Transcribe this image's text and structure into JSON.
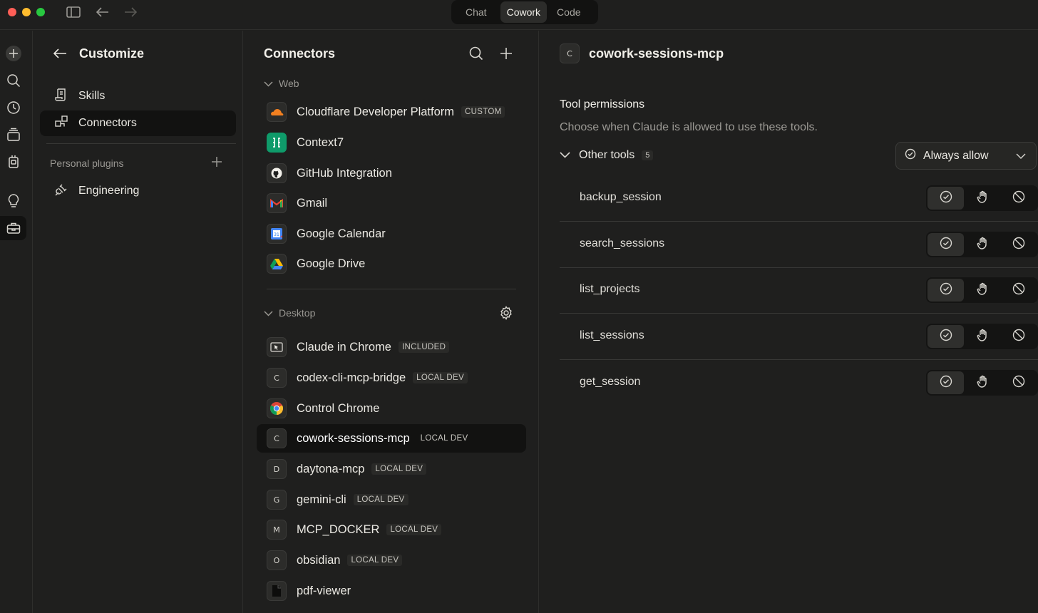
{
  "titlebar": {
    "mode_tabs": [
      "Chat",
      "Cowork",
      "Code"
    ],
    "active_mode": "Cowork",
    "traffic_colors": [
      "#ff5f57",
      "#febc2e",
      "#28c840"
    ]
  },
  "customize": {
    "title": "Customize",
    "nav": [
      {
        "label": "Skills",
        "icon": "scroll-icon"
      },
      {
        "label": "Connectors",
        "icon": "connectors-icon",
        "active": true
      }
    ],
    "personal_plugins_label": "Personal plugins",
    "plugins": [
      {
        "label": "Engineering",
        "icon": "plug-icon"
      }
    ]
  },
  "connectors": {
    "title": "Connectors",
    "web_section": "Web",
    "desktop_section": "Desktop",
    "web": [
      {
        "name": "Cloudflare Developer Platform",
        "badge": "CUSTOM",
        "icon": "cloudflare-icon"
      },
      {
        "name": "Context7",
        "badge": "",
        "icon": "context7-icon"
      },
      {
        "name": "GitHub Integration",
        "badge": "",
        "icon": "github-icon"
      },
      {
        "name": "Gmail",
        "badge": "",
        "icon": "gmail-icon"
      },
      {
        "name": "Google Calendar",
        "badge": "",
        "icon": "google-calendar-icon"
      },
      {
        "name": "Google Drive",
        "badge": "",
        "icon": "google-drive-icon"
      }
    ],
    "desktop": [
      {
        "name": "Claude in Chrome",
        "badge": "INCLUDED",
        "icon": "claude-chrome-icon",
        "letter": ""
      },
      {
        "name": "codex-cli-mcp-bridge",
        "badge": "LOCAL DEV",
        "icon": "letter-icon",
        "letter": "C"
      },
      {
        "name": "Control Chrome",
        "badge": "",
        "icon": "chrome-icon",
        "letter": ""
      },
      {
        "name": "cowork-sessions-mcp",
        "badge": "LOCAL DEV",
        "icon": "letter-icon",
        "letter": "C",
        "active": true
      },
      {
        "name": "daytona-mcp",
        "badge": "LOCAL DEV",
        "icon": "letter-icon",
        "letter": "D"
      },
      {
        "name": "gemini-cli",
        "badge": "LOCAL DEV",
        "icon": "letter-icon",
        "letter": "G"
      },
      {
        "name": "MCP_DOCKER",
        "badge": "LOCAL DEV",
        "icon": "letter-icon",
        "letter": "M"
      },
      {
        "name": "obsidian",
        "badge": "LOCAL DEV",
        "icon": "letter-icon",
        "letter": "O"
      },
      {
        "name": "pdf-viewer",
        "badge": "",
        "icon": "document-icon",
        "letter": ""
      }
    ]
  },
  "detail": {
    "letter": "C",
    "title": "cowork-sessions-mcp",
    "permissions_heading": "Tool permissions",
    "permissions_sub": "Choose when Claude is allowed to use these tools.",
    "group_label": "Other tools",
    "group_count": "5",
    "group_policy": "Always allow",
    "tools": [
      {
        "name": "backup_session",
        "permission": "allow"
      },
      {
        "name": "search_sessions",
        "permission": "allow"
      },
      {
        "name": "list_projects",
        "permission": "allow"
      },
      {
        "name": "list_sessions",
        "permission": "allow"
      },
      {
        "name": "get_session",
        "permission": "allow"
      }
    ]
  }
}
